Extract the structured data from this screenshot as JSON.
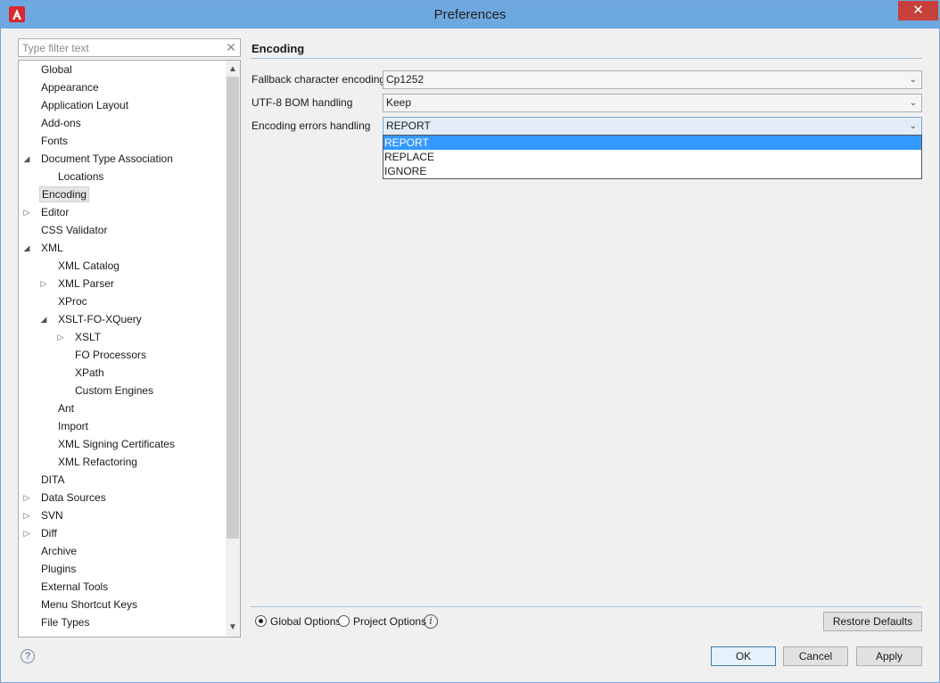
{
  "window": {
    "title": "Preferences",
    "close_glyph": "✕"
  },
  "filter": {
    "placeholder": "Type filter text",
    "clear_glyph": "✕"
  },
  "tree": [
    {
      "label": "Global",
      "toggle": ""
    },
    {
      "label": "Appearance",
      "toggle": ""
    },
    {
      "label": "Application Layout",
      "toggle": ""
    },
    {
      "label": "Add-ons",
      "toggle": ""
    },
    {
      "label": "Fonts",
      "toggle": ""
    },
    {
      "label": "Document Type Association",
      "toggle": "◢"
    },
    {
      "label": "Locations",
      "toggle": ""
    },
    {
      "label": "Encoding",
      "toggle": "",
      "selected": true
    },
    {
      "label": "Editor",
      "toggle": "▷"
    },
    {
      "label": "CSS Validator",
      "toggle": ""
    },
    {
      "label": "XML",
      "toggle": "◢"
    },
    {
      "label": "XML Catalog",
      "toggle": ""
    },
    {
      "label": "XML Parser",
      "toggle": "▷"
    },
    {
      "label": "XProc",
      "toggle": ""
    },
    {
      "label": "XSLT-FO-XQuery",
      "toggle": "◢"
    },
    {
      "label": "XSLT",
      "toggle": "▷"
    },
    {
      "label": "FO Processors",
      "toggle": ""
    },
    {
      "label": "XPath",
      "toggle": ""
    },
    {
      "label": "Custom Engines",
      "toggle": ""
    },
    {
      "label": "Ant",
      "toggle": ""
    },
    {
      "label": "Import",
      "toggle": ""
    },
    {
      "label": "XML Signing Certificates",
      "toggle": ""
    },
    {
      "label": "XML Refactoring",
      "toggle": ""
    },
    {
      "label": "DITA",
      "toggle": ""
    },
    {
      "label": "Data Sources",
      "toggle": "▷"
    },
    {
      "label": "SVN",
      "toggle": "▷"
    },
    {
      "label": "Diff",
      "toggle": "▷"
    },
    {
      "label": "Archive",
      "toggle": ""
    },
    {
      "label": "Plugins",
      "toggle": ""
    },
    {
      "label": "External Tools",
      "toggle": ""
    },
    {
      "label": "Menu Shortcut Keys",
      "toggle": ""
    },
    {
      "label": "File Types",
      "toggle": ""
    }
  ],
  "page": {
    "title": "Encoding",
    "fields": [
      {
        "label": "Fallback character encoding",
        "value": "Cp1252"
      },
      {
        "label": "UTF-8 BOM handling",
        "value": "Keep"
      },
      {
        "label": "Encoding errors handling",
        "value": "REPORT"
      }
    ],
    "dropdown_options": [
      "REPORT",
      "REPLACE",
      "IGNORE"
    ],
    "highlighted_option": "REPORT"
  },
  "options": {
    "global_label": "Global Options",
    "project_label": "Project Options",
    "selected": "Global Options",
    "info_glyph": "i"
  },
  "buttons": {
    "restore_defaults": "Restore Defaults",
    "ok": "OK",
    "cancel": "Cancel",
    "apply": "Apply",
    "help_glyph": "?"
  },
  "icons": {
    "app": "app-logo-icon",
    "combo_chevron": "chevron-down-icon",
    "chevron_glyph": "⌄",
    "scroll_up_glyph": "▲",
    "scroll_down_glyph": "▼"
  },
  "colors": {
    "titlebar": "#6ea8e0",
    "close": "#c7413c",
    "highlight": "#3399ff"
  }
}
